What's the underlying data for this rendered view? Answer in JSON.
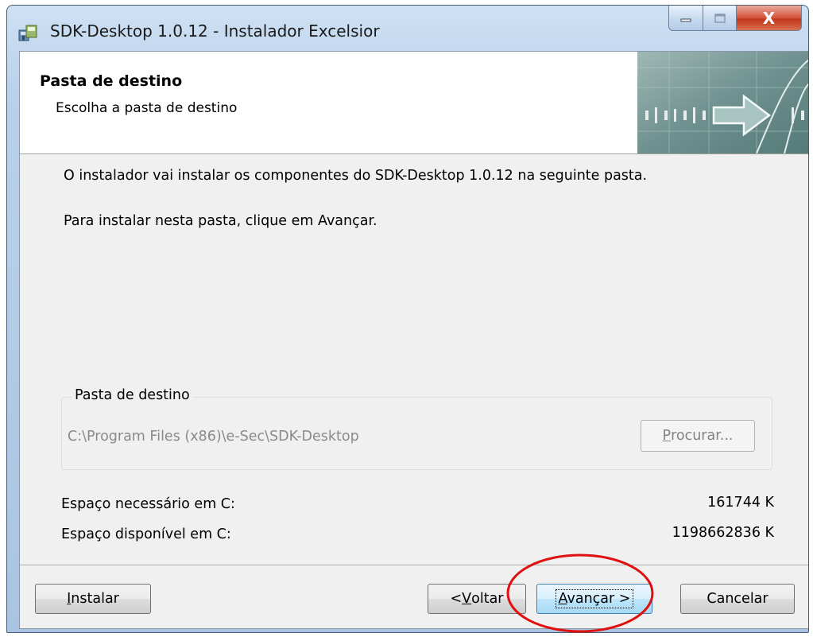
{
  "window": {
    "title": "SDK-Desktop 1.0.12 - Instalador Excelsior",
    "icons": {
      "app": "installer-app-icon",
      "minimize": "minimize-icon",
      "maximize": "maximize-icon",
      "close": "close-icon"
    },
    "close_glyph": "X"
  },
  "header": {
    "title": "Pasta de destino",
    "subtitle": "Escolha a pasta de destino",
    "banner_icon": "arrow-right-banner-icon"
  },
  "body": {
    "line1": "O instalador vai instalar os componentes do SDK-Desktop 1.0.12 na seguinte pasta.",
    "line2": "Para instalar nesta pasta, clique em Avançar."
  },
  "destination": {
    "group_label": "Pasta de destino",
    "path": "C:\\Program Files (x86)\\e-Sec\\SDK-Desktop",
    "browse_button": {
      "pre": "",
      "accel": "P",
      "post": "rocurar...",
      "enabled": false
    }
  },
  "space": {
    "required_label": "Espaço necessário em C:",
    "required_value": "161744 K",
    "available_label": "Espaço disponível em C:",
    "available_value": "1198662836 K"
  },
  "buttons": {
    "install": {
      "pre": "",
      "accel": "I",
      "post": "nstalar"
    },
    "back": {
      "pre": "< ",
      "accel": "V",
      "post": "oltar"
    },
    "next": {
      "pre": "",
      "accel": "A",
      "post": "vançar >"
    },
    "cancel": {
      "pre": "",
      "accel": "",
      "post": "Cancelar"
    }
  },
  "colors": {
    "highlight_ring": "#e01010",
    "title_bar": "#b9d1ea",
    "close_button": "#c7432a"
  }
}
